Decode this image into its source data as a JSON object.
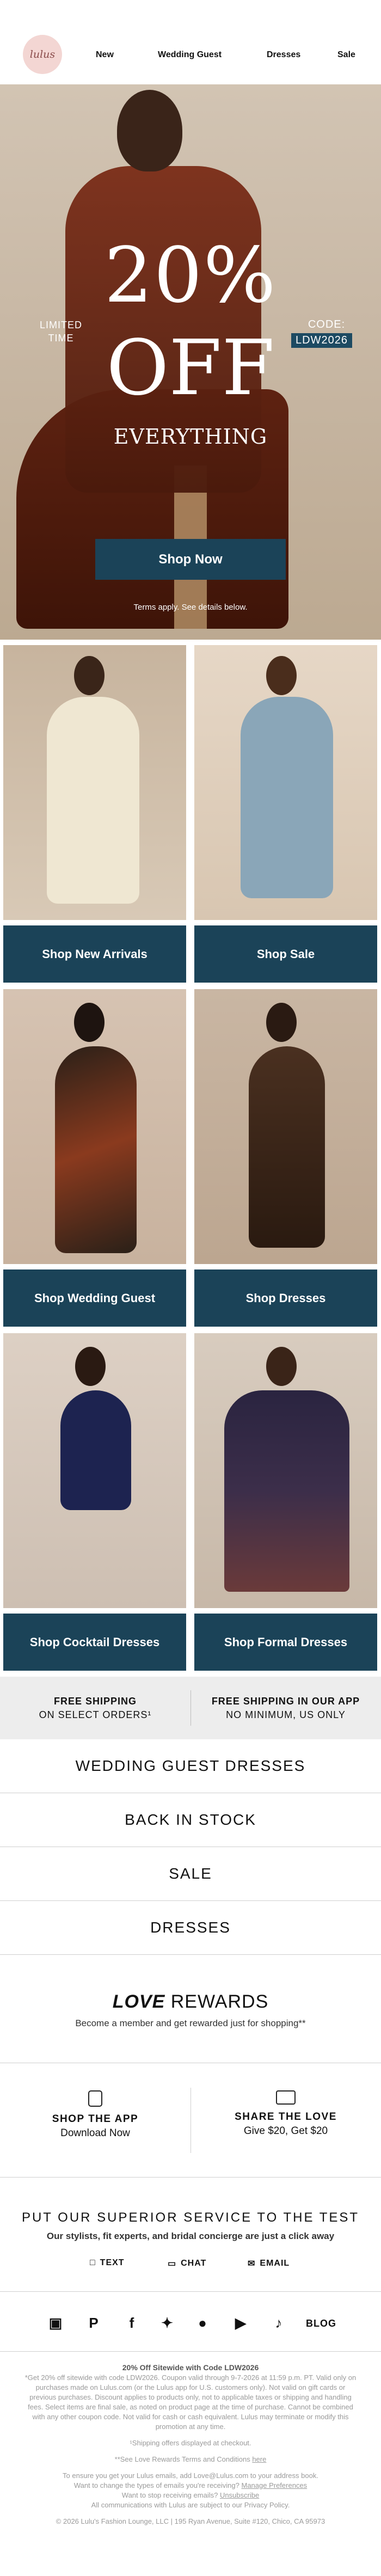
{
  "header": {
    "logo_text": "lulus",
    "nav": [
      "New",
      "Wedding Guest",
      "Dresses",
      "Sale"
    ]
  },
  "hero": {
    "limited_line1": "LIMITED",
    "limited_line2": "TIME",
    "percent": "20%",
    "off": "OFF",
    "everything": "EVERYTHING",
    "code_label": "CODE:",
    "code_value": "LDW2026",
    "button": "Shop Now",
    "terms": "Terms apply. See details below."
  },
  "tiles": [
    {
      "label": "Shop New Arrivals"
    },
    {
      "label": "Shop Sale"
    },
    {
      "label": "Shop Wedding Guest"
    },
    {
      "label": "Shop Dresses"
    },
    {
      "label": "Shop Cocktail Dresses"
    },
    {
      "label": "Shop Formal Dresses"
    }
  ],
  "shipping": {
    "left_title": "FREE SHIPPING",
    "left_sub": "ON SELECT ORDERS¹",
    "right_title": "FREE SHIPPING IN OUR APP",
    "right_sub": "NO MINIMUM, US ONLY"
  },
  "links": [
    "WEDDING GUEST DRESSES",
    "BACK IN STOCK",
    "SALE",
    "DRESSES"
  ],
  "rewards": {
    "title_bold": "LOVE",
    "title_rest": " REWARDS",
    "subtitle": "Become a member and get rewarded just for shopping**"
  },
  "app": {
    "title": "SHOP THE APP",
    "sub": "Download Now"
  },
  "love": {
    "title": "SHARE THE LOVE",
    "sub": "Give $20, Get $20"
  },
  "service": {
    "title": "PUT OUR SUPERIOR SERVICE TO THE TEST",
    "subtitle": "Our stylists, fit experts, and bridal concierge are just a click away",
    "text": "TEXT",
    "chat": "CHAT",
    "email": "EMAIL"
  },
  "social": {
    "blog": "BLOG",
    "icons": [
      "instagram-icon",
      "pinterest-icon",
      "facebook-icon",
      "twitter-icon",
      "snapchat-icon",
      "youtube-icon",
      "tiktok-icon"
    ]
  },
  "footer": {
    "title": "20% Off Sitewide with Code LDW2026",
    "p1": "*Get 20% off sitewide with code LDW2026. Coupon valid through 9-7-2026 at 11:59 p.m. PT. Valid only on purchases made on Lulus.com (or the Lulus app for U.S. customers only). Not valid on gift cards or previous purchases. Discount applies to products only, not to applicable taxes or shipping and handling fees. Select items are final sale, as noted on product page at the time of purchase. Cannot be combined with any other coupon code. Not valid for cash or cash equivalent. Lulus may terminate or modify this promotion at any time.",
    "p2": "¹Shipping offers displayed at checkout.",
    "p3_pre": "**See Love Rewards Terms and Conditions ",
    "p3_link": "here",
    "p4": "To ensure you get your Lulus emails, add Love@Lulus.com to your address book.",
    "p5_pre": "Want to change the types of emails you're receiving? ",
    "p5_link": "Manage Preferences",
    "p6_pre": "Want to stop receiving emails? ",
    "p6_link": "Unsubscribe",
    "p7": "All communications with Lulus are subject to our Privacy Policy.",
    "copyright": "© 2026 Lulu's Fashion Lounge, LLC | 195 Ryan Avenue, Suite #120, Chico, CA 95973"
  }
}
